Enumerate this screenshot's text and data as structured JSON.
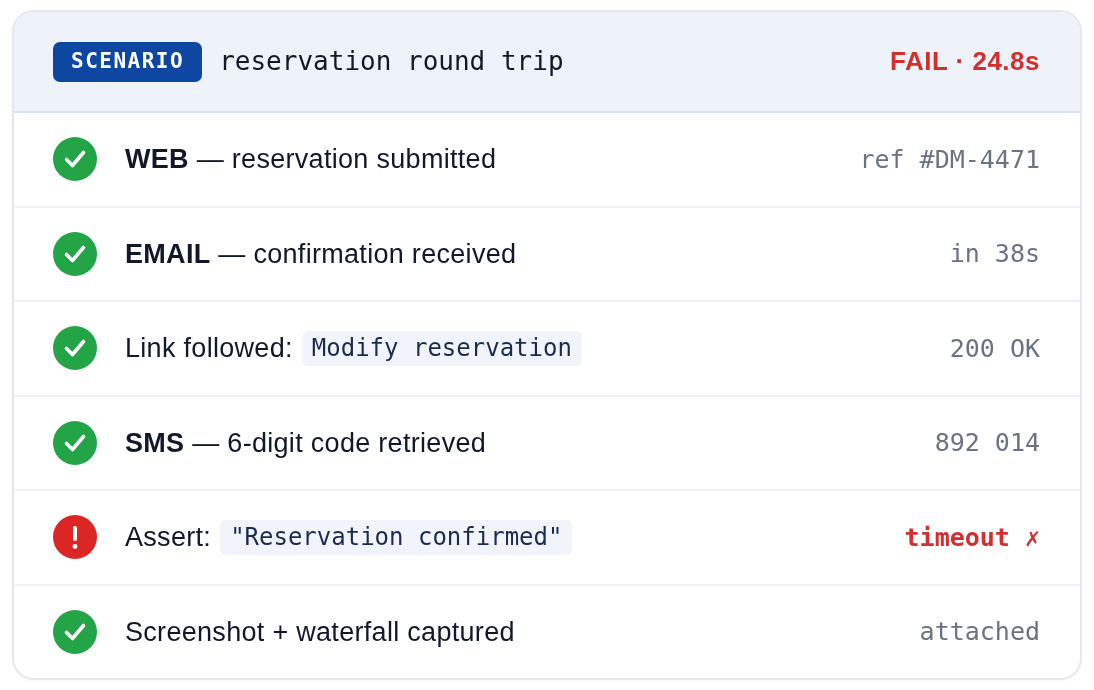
{
  "header": {
    "badge": "SCENARIO",
    "title": "reservation round trip",
    "failed": true,
    "result": "FAIL · 24.8s"
  },
  "steps": [
    {
      "kind": "text",
      "failed": false,
      "text": "**WEB** — reservation submitted",
      "detail": "ref #DM-4471"
    },
    {
      "kind": "text",
      "failed": false,
      "text": "**EMAIL** — confirmation received",
      "detail": "in 38s"
    },
    {
      "kind": "code",
      "failed": false,
      "text": "Link followed:",
      "code": "Modify reservation",
      "detail": "200 OK"
    },
    {
      "kind": "text",
      "failed": false,
      "text": "**SMS** — 6-digit code retrieved",
      "detail": "892 014"
    },
    {
      "kind": "code",
      "failed": true,
      "text": "Assert:",
      "code": "\"Reservation confirmed\"",
      "detail": "timeout ✗"
    },
    {
      "kind": "text",
      "failed": false,
      "text": "Screenshot + waterfall captured",
      "detail": "attached"
    }
  ]
}
